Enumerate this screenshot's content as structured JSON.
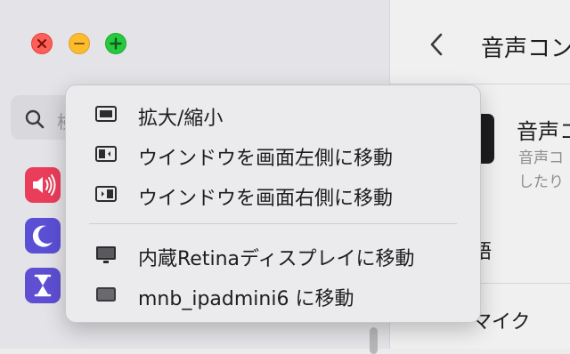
{
  "search": {
    "placeholder": "検"
  },
  "main": {
    "title": "音声コン",
    "item_title": "音声コ",
    "item_desc_line1": "音声コ",
    "item_desc_line2": "したり",
    "row_a": "語",
    "row_b": "マイク"
  },
  "menu": {
    "items": [
      {
        "label": "拡大/縮小",
        "icon": "fullscreen-icon"
      },
      {
        "label": "ウインドウを画面左側に移動",
        "icon": "tile-left-icon"
      },
      {
        "label": "ウインドウを画面右側に移動",
        "icon": "tile-right-icon"
      },
      {
        "label": "内蔵Retinaディスプレイに移動",
        "icon": "display-icon"
      },
      {
        "label": "mnb_ipadmini6 に移動",
        "icon": "ipad-icon"
      }
    ]
  },
  "colors": {
    "close": "#fe5f57",
    "minimize": "#fdbc2e",
    "zoom": "#28c840",
    "sound_icon": "#ea3d5a",
    "focus_icon": "#5b4fd6",
    "screen_time_icon": "#5e4fd3"
  },
  "sidebar_icons": [
    "speaker-icon",
    "moon-icon",
    "hourglass-icon"
  ]
}
